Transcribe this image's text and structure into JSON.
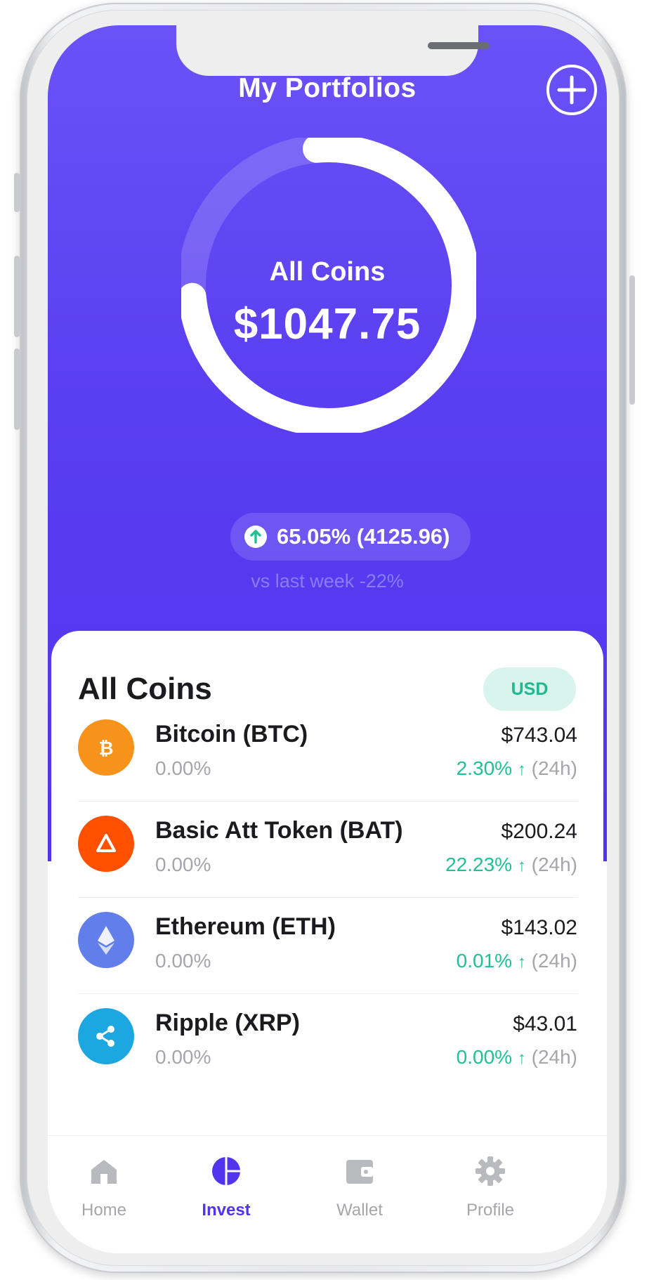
{
  "header": {
    "title": "My Portfolios"
  },
  "portfolio": {
    "label": "All Coins",
    "total": "$1047.75",
    "progress_fraction": 0.75,
    "change": "65.05% (4125.96)",
    "vs_last_week": "vs last week -22%"
  },
  "coins_card": {
    "title": "All Coins",
    "currency": "USD",
    "coins": [
      {
        "name": "Bitcoin (BTC)",
        "pct": "0.00%",
        "price": "$743.04",
        "change": "2.30%",
        "period": "(24h)",
        "color": "#f7931a",
        "icon": "bitcoin-icon"
      },
      {
        "name": "Basic Att Token (BAT)",
        "pct": "0.00%",
        "price": "$200.24",
        "change": "22.23%",
        "period": "(24h)",
        "color": "#ff5000",
        "icon": "bat-icon"
      },
      {
        "name": "Ethereum (ETH)",
        "pct": "0.00%",
        "price": "$143.02",
        "change": "0.01%",
        "period": "(24h)",
        "color": "#627eea",
        "icon": "ethereum-icon"
      },
      {
        "name": "Ripple (XRP)",
        "pct": "0.00%",
        "price": "$43.01",
        "change": "0.00%",
        "period": "(24h)",
        "color": "#1ca7e0",
        "icon": "ripple-icon"
      }
    ]
  },
  "nav": {
    "items": [
      {
        "label": "Home",
        "icon": "home-icon",
        "active": false
      },
      {
        "label": "Invest",
        "icon": "pie-chart-icon",
        "active": true
      },
      {
        "label": "Wallet",
        "icon": "wallet-icon",
        "active": false
      },
      {
        "label": "Profile",
        "icon": "gear-icon",
        "active": false
      }
    ]
  },
  "colors": {
    "accent": "#5233ee",
    "positive": "#22c095",
    "muted": "#a4a6ab"
  }
}
